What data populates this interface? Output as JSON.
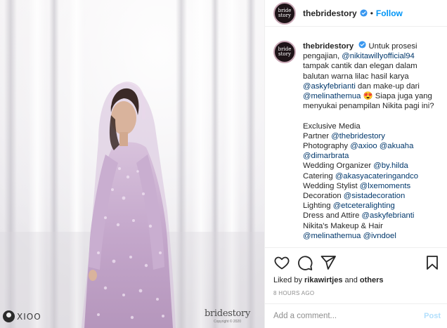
{
  "post": {
    "username": "thebridestory",
    "separator": "•",
    "follow_label": "Follow",
    "avatar_text": [
      "bride",
      "story"
    ],
    "caption": {
      "line1_pre": "Untuk prosesi",
      "line2_pre": "pengajian, ",
      "line2_m": "@nikitawillyofficial94",
      "line3": "tampak cantik dan elegan dalam",
      "line4": "balutan warna lilac hasil karya",
      "line5_m": "@askyfebrianti",
      "line5_post": " dan make-up dari",
      "line6_m": "@melinathemua",
      "line6_emoji": "😍",
      "line6_post": " Siapa juga yang",
      "line7": "menyukai penampilan Nikita pagi ini?",
      "credits_title": "Exclusive Media",
      "credit_partner_pre": "Partner ",
      "credit_partner_m": "@thebridestory",
      "credit_photo_pre": "Photography ",
      "credit_photo_m1": "@axioo",
      "credit_photo_m2": "@akuaha",
      "credit_photo_m3": "@dimarbrata",
      "credit_wo_pre": "Wedding Organizer ",
      "credit_wo_m": "@by.hilda",
      "credit_cat_pre": "Catering ",
      "credit_cat_m": "@akasyacateringandco",
      "credit_sty_pre": "Wedding Stylist ",
      "credit_sty_m": "@lxemoments",
      "credit_dec_pre": "Decoration ",
      "credit_dec_m": "@sistadecoration",
      "credit_light_pre": "Lighting ",
      "credit_light_m": "@etceteralighting",
      "credit_dress_pre": "Dress and Attire ",
      "credit_dress_m": "@askyfebrianti",
      "credit_mua_pre": "Nikita's Makeup & Hair",
      "credit_mua_m1": "@melinathemua",
      "credit_mua_m2": "@ivndoel"
    },
    "liked_by_pre": "Liked by ",
    "liked_by_user": "rikawirtjes",
    "liked_by_mid": " and ",
    "liked_by_others": "others",
    "timestamp": "8 HOURS AGO",
    "comment_placeholder": "Add a comment...",
    "post_button": "Post"
  },
  "photo": {
    "watermark_left": "XIOO",
    "watermark_right": "bridestory",
    "watermark_copy": "Copyright © 2020"
  },
  "icons": {
    "like": "heart-icon",
    "comment": "comment-bubble-icon",
    "share": "paper-plane-icon",
    "save": "bookmark-icon",
    "verified": "verified-badge-icon"
  },
  "colors": {
    "link": "#0095f6",
    "mention": "#00376b",
    "muted": "#8e8e8e",
    "gown": "#c7a9cf"
  }
}
